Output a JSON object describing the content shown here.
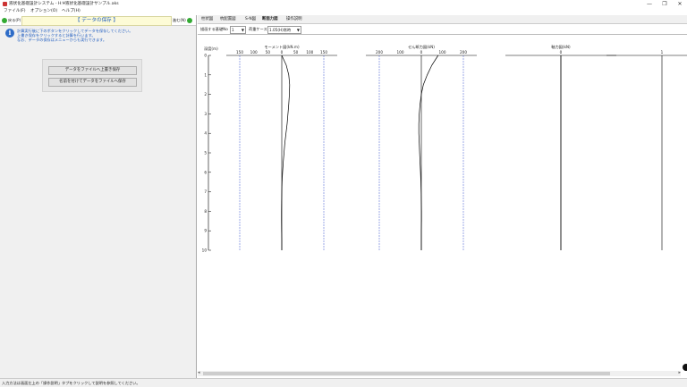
{
  "window": {
    "title": "液状化基礎設計システム - H:¥液状化基礎設計サンプル.aks",
    "minimize": "—",
    "maximize": "❐",
    "close": "✕"
  },
  "menu": [
    "ファイル(F)",
    "オプション(O)",
    "ヘルプ(H)"
  ],
  "left": {
    "back_label": "戻る(P)",
    "next_label": "進む(N)",
    "header": "【 データの保存 】",
    "messages": [
      "計算実行後に下のボタンをクリックしてデータを保存してください。",
      "上書き保存をクリックすると計算を行います。",
      "なお、データの保存はメニューからも実行できます。"
    ],
    "buttons": {
      "overwrite_save": "データをファイルへ上書き保存",
      "save_as": "名前を付けてデータをファイルへ保存"
    }
  },
  "tabs": [
    "柱状図",
    "杭配置図",
    "S-N図",
    "断面力図",
    "操作説明"
  ],
  "active_tab": 3,
  "controls": {
    "pile_label": "描画する基礎No",
    "pile_value": "1",
    "load_label": "荷重ケース",
    "load_value": "1.05(H)常時"
  },
  "chart_data": {
    "type": "line",
    "depth_label": "深度(m)",
    "depth_ticks": [
      0,
      1,
      2,
      3,
      4,
      5,
      6,
      7,
      8,
      9,
      10
    ],
    "depth_range": [
      0,
      10
    ],
    "panels": [
      {
        "title": "モーメント図(kN.m)",
        "ticks": [
          150,
          100,
          50,
          0,
          50,
          100,
          150
        ],
        "range": [
          -150,
          150
        ],
        "limits": [
          -150,
          150
        ],
        "depth": [
          0,
          0.5,
          1,
          1.5,
          2,
          2.5,
          3,
          3.5,
          4,
          4.5,
          5,
          5.5,
          6,
          6.5,
          7,
          7.5,
          8,
          8.5,
          9,
          9.5,
          10
        ],
        "values": [
          0,
          16,
          25,
          28,
          27,
          25,
          22,
          19,
          15,
          11,
          8,
          5,
          3,
          1,
          0,
          -0.5,
          -1,
          -1,
          -0.5,
          0,
          0
        ]
      },
      {
        "title": "せん断力図(kN)",
        "ticks": [
          200,
          100,
          0,
          100,
          200
        ],
        "range": [
          -200,
          200
        ],
        "limits": [
          -200,
          200
        ],
        "depth": [
          0,
          0.5,
          1,
          1.5,
          2,
          2.5,
          3,
          3.5,
          4,
          4.5,
          5,
          5.5,
          6,
          6.5,
          7,
          7.5,
          8,
          8.5,
          9,
          9.5,
          10
        ],
        "values": [
          80,
          50,
          28,
          10,
          0,
          -6,
          -10,
          -12,
          -12,
          -10,
          -8,
          -6,
          -4,
          -2,
          -1,
          0,
          1,
          1,
          0,
          0,
          0
        ]
      },
      {
        "title": "軸力図(kN)",
        "ticks": [
          0
        ],
        "range": [
          -100,
          100
        ],
        "limits": [],
        "depth": [
          0,
          10
        ],
        "values": [
          0,
          0
        ]
      },
      {
        "title": "",
        "ticks": [
          1
        ],
        "range": [
          -1,
          1
        ],
        "limits": [],
        "depth": [],
        "values": []
      }
    ]
  },
  "status": "入力方法は画面左上の「操作説明」タブをクリックして説明を参照してください。"
}
